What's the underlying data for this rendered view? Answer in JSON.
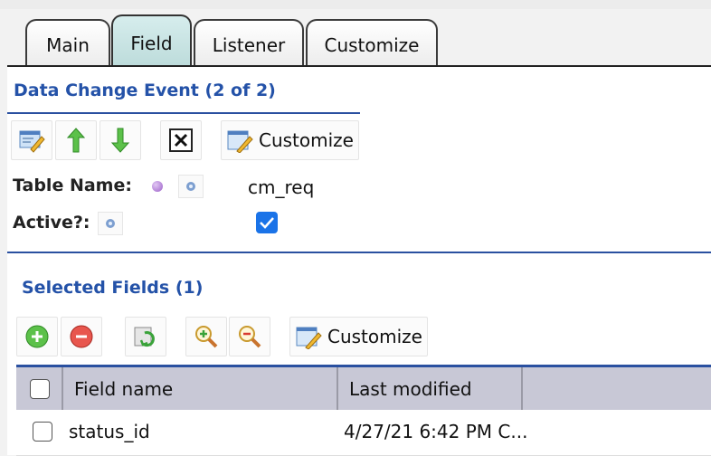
{
  "tabs": [
    {
      "label": "Main",
      "active": false
    },
    {
      "label": "Field",
      "active": true
    },
    {
      "label": "Listener",
      "active": false
    },
    {
      "label": "Customize",
      "active": false
    }
  ],
  "event_section": {
    "title": "Data Change Event (2 of 2)",
    "toolbar": {
      "customize_label": "Customize"
    },
    "table_name_label": "Table Name:",
    "table_name_value": "cm_req",
    "active_label": "Active?:",
    "active_checked": true
  },
  "fields_section": {
    "title": "Selected Fields (1)",
    "toolbar": {
      "customize_label": "Customize"
    },
    "columns": [
      "Field name",
      "Last modified"
    ],
    "rows": [
      {
        "field_name": "status_id",
        "last_modified": "4/27/21 6:42 PM C..."
      }
    ]
  },
  "colors": {
    "accent": "#2452a8",
    "active_tab": "#b9d9d8",
    "checkbox": "#1a73e8",
    "header": "#c8c8d6"
  }
}
